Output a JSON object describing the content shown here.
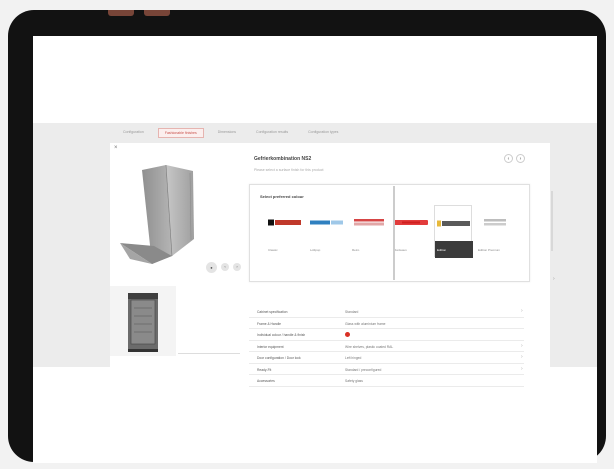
{
  "tabs": [
    {
      "label": "Configuration"
    },
    {
      "label": "Fashionable finishes"
    },
    {
      "label": "Dimensions"
    },
    {
      "label": "Configuration results"
    },
    {
      "label": "Configuration types"
    }
  ],
  "product_title": "Gefrierkombination NS2",
  "product_subtitle": "Please select a surface finish for this product",
  "nav": {
    "prev": "‹",
    "next": "›"
  },
  "viewer": {
    "close": "×",
    "rotate_left": "‹",
    "rotate_right": "›",
    "play": "●"
  },
  "brand_picker": {
    "title": "Select preferred colour",
    "brands": [
      {
        "name": "Classic",
        "color": "#c0392b",
        "accent": "#111111"
      },
      {
        "name": "Lollipop",
        "color": "#2f80c0",
        "accent": "#9fc8e8"
      },
      {
        "name": "Retro",
        "color": "#d64545",
        "accent": "#e2a6a6"
      },
      {
        "name": "Bordeaux",
        "color": "#e23c3c",
        "accent": "#d01f1f"
      },
      {
        "name": "Edition",
        "color": "#5a5a5a",
        "accent": "#e7b93b"
      },
      {
        "name": "Edition Premium",
        "color": "#bdbdbd",
        "accent": "#cccccc"
      }
    ]
  },
  "rows": [
    {
      "key": "Cabinet specification",
      "value": "Standard"
    },
    {
      "key": "Frame & Handle",
      "value": "Glass with aluminium frame"
    },
    {
      "key": "Individual colour / handle & finish",
      "value": ""
    },
    {
      "key": "Interior equipment",
      "value": "Wire shelves, plastic coated RAL"
    },
    {
      "key": "Door configuration / Door lock",
      "value": "Left hinged"
    },
    {
      "key": "Ready-Fit",
      "value": "Standard / preconfigured"
    },
    {
      "key": "Accessories",
      "value": "Safety glass"
    }
  ],
  "colors": {
    "accent": "#c8504a",
    "dot": "#d93025"
  }
}
